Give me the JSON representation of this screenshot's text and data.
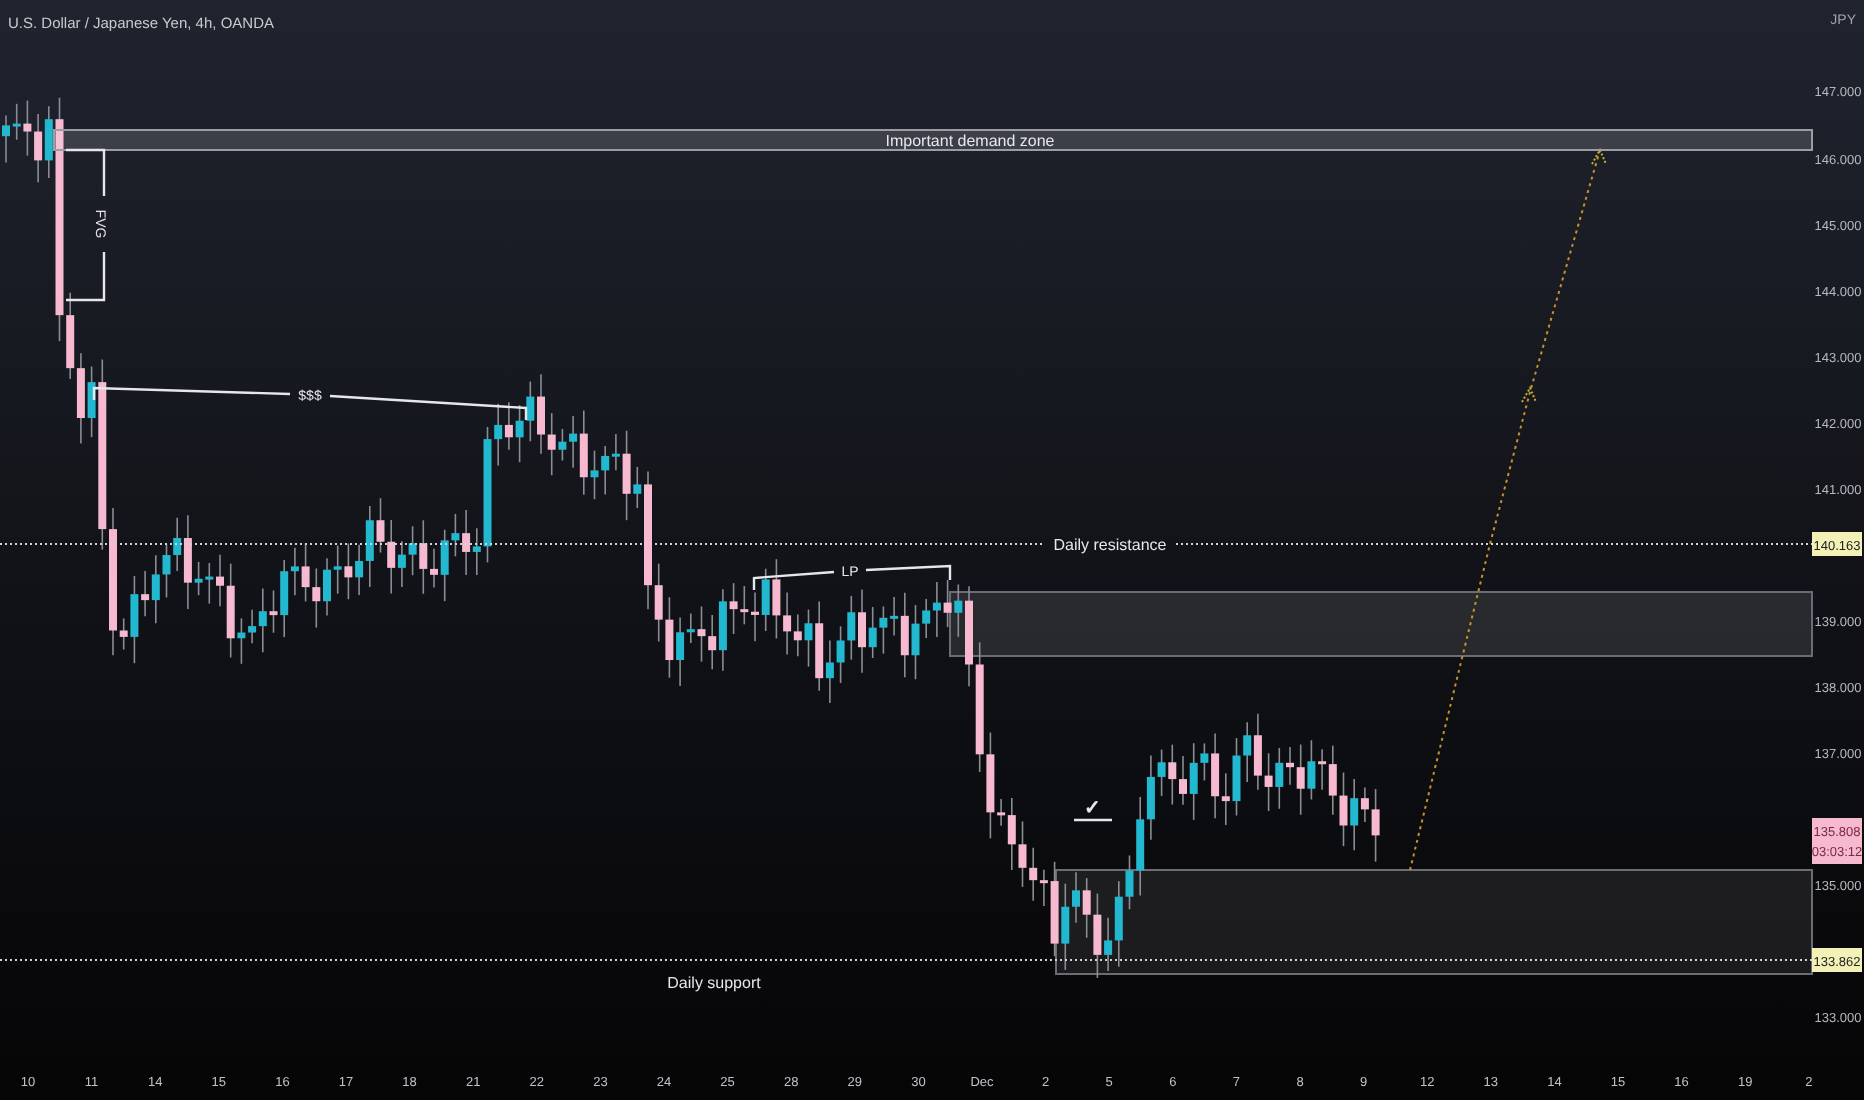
{
  "title": "U.S. Dollar / Japanese Yen, 4h, OANDA",
  "currency": "JPY",
  "price_axis": [
    "147.000",
    "146.000",
    "145.000",
    "144.000",
    "143.000",
    "142.000",
    "141.000",
    "139.000",
    "138.000",
    "137.000",
    "135.000",
    "133.000"
  ],
  "price_labels": [
    {
      "kind": "level",
      "text": "140.163"
    },
    {
      "kind": "last",
      "text": "135.808",
      "countdown": "03:03:12"
    },
    {
      "kind": "level",
      "text": "133.862"
    }
  ],
  "time_axis": [
    "10",
    "11",
    "14",
    "15",
    "16",
    "17",
    "18",
    "21",
    "22",
    "23",
    "24",
    "25",
    "28",
    "29",
    "30",
    "Dec",
    "2",
    "5",
    "6",
    "7",
    "8",
    "9",
    "12",
    "13",
    "14",
    "15",
    "16",
    "19",
    "2"
  ],
  "annotations": [
    {
      "kind": "zone",
      "label": "Important demand zone"
    },
    {
      "kind": "bracket",
      "label": "FVG"
    },
    {
      "kind": "line",
      "label": "$$$"
    },
    {
      "kind": "dotted",
      "label": "Daily resistance"
    },
    {
      "kind": "line",
      "label": "LP"
    },
    {
      "kind": "check",
      "label": "✓"
    },
    {
      "kind": "dotted",
      "label": "Daily support"
    }
  ]
}
